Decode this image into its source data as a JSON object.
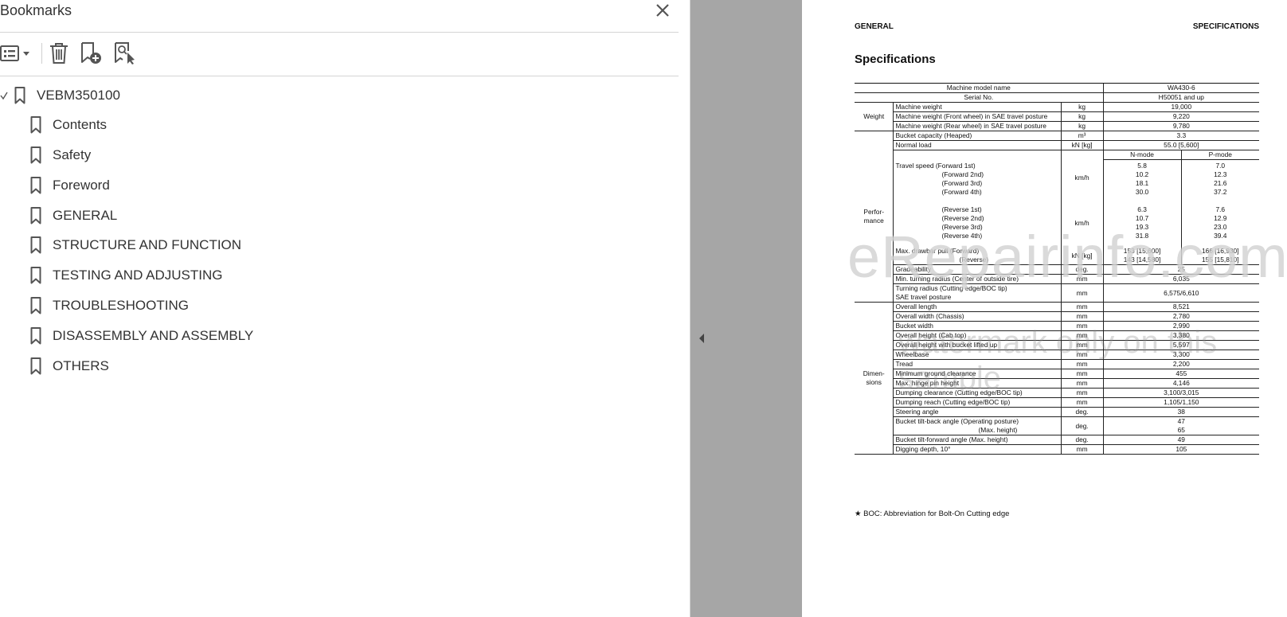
{
  "bookmarks_panel": {
    "title": "Bookmarks",
    "items": [
      {
        "label": "VEBM350100"
      },
      {
        "label": "Contents"
      },
      {
        "label": "Safety"
      },
      {
        "label": "Foreword"
      },
      {
        "label": "GENERAL"
      },
      {
        "label": "STRUCTURE AND FUNCTION"
      },
      {
        "label": "TESTING AND ADJUSTING"
      },
      {
        "label": "TROUBLESHOOTING"
      },
      {
        "label": "DISASSEMBLY AND ASSEMBLY"
      },
      {
        "label": "OTHERS"
      }
    ]
  },
  "document": {
    "header_left": "GENERAL",
    "header_right": "SPECIFICATIONS",
    "heading": "Specifications",
    "table": {
      "model_label": "Machine model name",
      "model_value": "WA430-6",
      "serial_label": "Serial No.",
      "serial_value": "H50051 and up",
      "weight_group": "Weight",
      "weight_rows": [
        {
          "item": "Machine weight",
          "unit": "kg",
          "value": "19,000"
        },
        {
          "item": "Machine weight (Front wheel) in SAE travel posture",
          "unit": "kg",
          "value": "9,220"
        },
        {
          "item": "Machine weight (Rear wheel) in SAE travel posture",
          "unit": "kg",
          "value": "9,780"
        }
      ],
      "perf_group": "Perfor-\nmance",
      "bucket_capacity": {
        "item": "Bucket capacity (Heaped)",
        "unit": "m³",
        "value": "3.3"
      },
      "normal_load": {
        "item": "Normal load",
        "unit": "kN [kg]",
        "value": "55.0 [5,600]"
      },
      "mode_n": "N-mode",
      "mode_p": "P-mode",
      "travel_forward": {
        "items": [
          "Travel speed  (Forward 1st)",
          "(Forward 2nd)",
          "(Forward 3rd)",
          "(Forward 4th)"
        ],
        "unit": "km/h",
        "n": [
          "5.8",
          "10.2",
          "18.1",
          "30.0"
        ],
        "p": [
          "7.0",
          "12.3",
          "21.6",
          "37.2"
        ]
      },
      "travel_reverse": {
        "items": [
          "(Reverse 1st)",
          "(Reverse 2nd)",
          "(Reverse 3rd)",
          "(Reverse 4th)"
        ],
        "unit": "km/h",
        "n": [
          "6.3",
          "10.7",
          "19.3",
          "31.8"
        ],
        "p": [
          "7.6",
          "12.9",
          "23.0",
          "39.4"
        ]
      },
      "drawbar": {
        "items": [
          "Max. drawbar pull (Forward)",
          "(Reverse)"
        ],
        "unit": "kN [kg]",
        "n": [
          "153 [15,600]",
          "143 [14,580]"
        ],
        "p": [
          "166 [16,930]",
          "155 [15,810]"
        ]
      },
      "gradeability": {
        "item": "Gradeability",
        "unit": "deg.",
        "value": "25"
      },
      "min_turning": {
        "item": "Min. turning radius (Center of outside tire)",
        "unit": "mm",
        "value": "6,035"
      },
      "turning_radius": {
        "item": "Turning radius (Cutting edge/BOC tip)",
        "item2": "SAE travel posture",
        "unit": "mm",
        "value": "6,575/6,610"
      },
      "dim_group": "Dimen-\nsions",
      "dim_rows": [
        {
          "item": "Overall length",
          "unit": "mm",
          "value": "8,521"
        },
        {
          "item": "Overall width (Chassis)",
          "unit": "mm",
          "value": "2,780"
        },
        {
          "item": "Bucket width",
          "unit": "mm",
          "value": "2,990"
        },
        {
          "item": "Overall height (Cab top)",
          "unit": "mm",
          "value": "3,380"
        },
        {
          "item": "Overall height with bucket lifted up",
          "unit": "mm",
          "value": "5,597"
        },
        {
          "item": "Wheelbase",
          "unit": "mm",
          "value": "3,300"
        },
        {
          "item": "Tread",
          "unit": "mm",
          "value": "2,200"
        },
        {
          "item": "Minimum ground clearance",
          "unit": "mm",
          "value": "455"
        },
        {
          "item": "Max. hinge pin height",
          "unit": "mm",
          "value": "4,146"
        },
        {
          "item": "Dumping clearance (Cutting edge/BOC tip)",
          "unit": "mm",
          "value": "3,100/3,015"
        },
        {
          "item": "Dumping reach (Cutting edge/BOC tip)",
          "unit": "mm",
          "value": "1,105/1,150"
        },
        {
          "item": "Steering angle",
          "unit": "deg.",
          "value": "38"
        }
      ],
      "tiltback": {
        "items": [
          "Bucket tilt-back angle  (Operating posture)",
          "(Max. height)"
        ],
        "unit": "deg.",
        "values": [
          "47",
          "65"
        ]
      },
      "tiltforward": {
        "item": "Bucket tilt-forward angle (Max. height)",
        "unit": "deg.",
        "value": "49"
      },
      "digging": {
        "item": "Digging depth, 10°",
        "unit": "mm",
        "value": "105"
      }
    },
    "footnote": "★  BOC: Abbreviation for Bolt-On Cutting edge"
  },
  "watermark": {
    "line1": "eRepairinfo.com",
    "line2": "watermark only on this sample"
  },
  "colors": {
    "gutter": "#a6a6a6",
    "icon": "#555555"
  }
}
